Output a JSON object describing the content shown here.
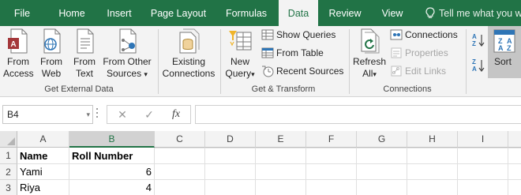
{
  "tabs": [
    {
      "label": "File"
    },
    {
      "label": "Home"
    },
    {
      "label": "Insert"
    },
    {
      "label": "Page Layout"
    },
    {
      "label": "Formulas"
    },
    {
      "label": "Data"
    },
    {
      "label": "Review"
    },
    {
      "label": "View"
    }
  ],
  "active_tab": "Data",
  "tell_me": "Tell me what you wa",
  "ribbon": {
    "get_external_data": {
      "label": "Get External Data",
      "from_access": {
        "line1": "From",
        "line2": "Access"
      },
      "from_web": {
        "line1": "From",
        "line2": "Web"
      },
      "from_text": {
        "line1": "From",
        "line2": "Text"
      },
      "from_other": {
        "line1": "From Other",
        "line2": "Sources",
        "arrow": "▾"
      },
      "existing": {
        "line1": "Existing",
        "line2": "Connections"
      }
    },
    "get_transform": {
      "label": "Get & Transform",
      "new_query": {
        "line1": "New",
        "line2": "Query",
        "arrow": "▾"
      },
      "show_queries": "Show Queries",
      "from_table": "From Table",
      "recent_sources": "Recent Sources"
    },
    "connections": {
      "label": "Connections",
      "refresh_all": {
        "line1": "Refresh",
        "line2": "All",
        "arrow": "▾"
      },
      "connections": "Connections",
      "properties": "Properties",
      "edit_links": "Edit Links"
    },
    "sort_filter": {
      "sort": "Sort"
    }
  },
  "formula_bar": {
    "name_box": "B4",
    "name_box_arrow": "▾",
    "cancel": "✕",
    "enter": "✓",
    "fx": "fx",
    "formula": ""
  },
  "grid": {
    "columns": [
      "A",
      "B",
      "C",
      "D",
      "E",
      "F",
      "G",
      "H",
      "I"
    ],
    "selected_column": "B",
    "rows": [
      {
        "num": "1",
        "cells": [
          "Name",
          "Roll Number"
        ]
      },
      {
        "num": "2",
        "cells": [
          "Yami",
          "6"
        ]
      },
      {
        "num": "3",
        "cells": [
          "Riya",
          "4"
        ]
      }
    ]
  },
  "colors": {
    "excel_green": "#217346",
    "ribbon_bg": "#f3f3f3",
    "sort_highlight": "#c5c5c5"
  }
}
